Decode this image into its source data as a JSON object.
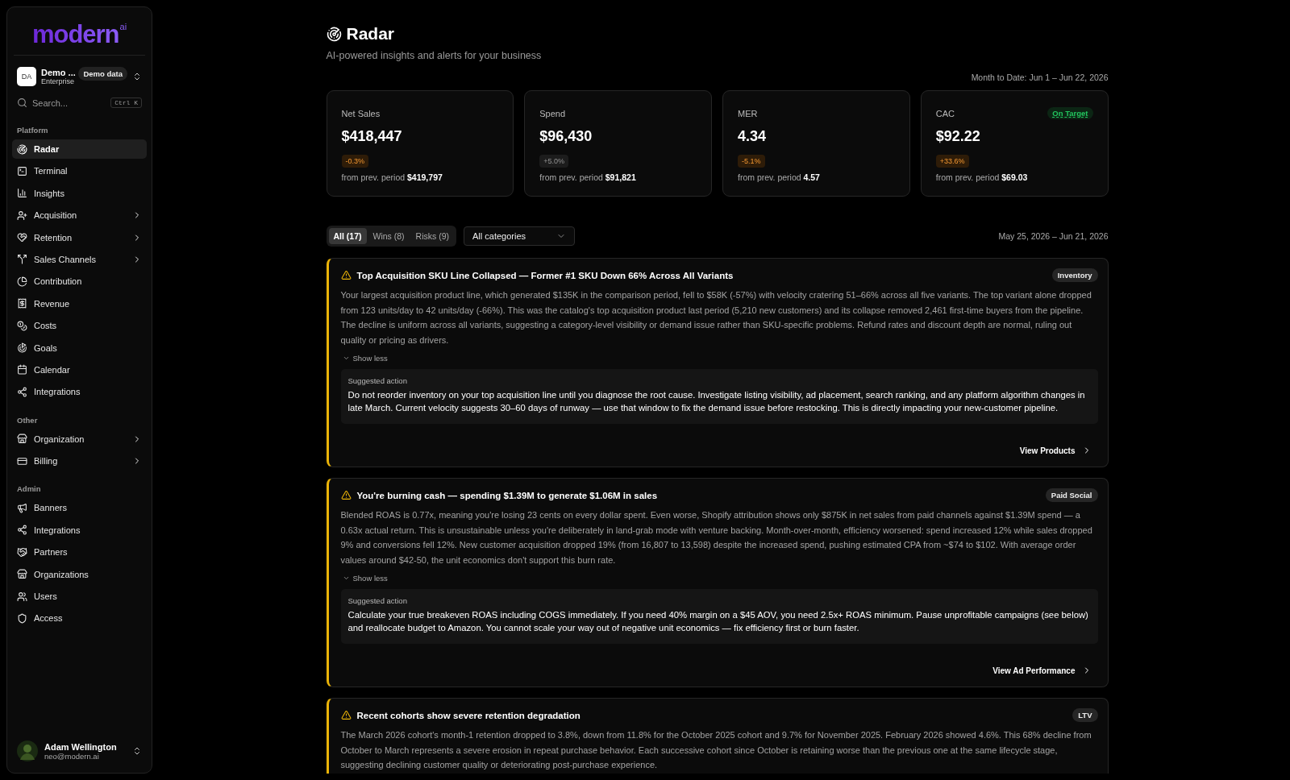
{
  "sidebar": {
    "logo": {
      "text": "modern",
      "superscript": "ai"
    },
    "org": {
      "initials": "DA",
      "name": "Demo ...",
      "plan": "Enterprise",
      "badge": "Demo data"
    },
    "search": {
      "placeholder": "Search...",
      "shortcut": "Ctrl K"
    },
    "sections": [
      {
        "title": "Platform",
        "items": [
          {
            "label": "Radar",
            "selected": true,
            "submenu": false
          },
          {
            "label": "Terminal",
            "selected": false,
            "submenu": false
          },
          {
            "label": "Insights",
            "selected": false,
            "submenu": false
          },
          {
            "label": "Acquisition",
            "selected": false,
            "submenu": true
          },
          {
            "label": "Retention",
            "selected": false,
            "submenu": true
          },
          {
            "label": "Sales Channels",
            "selected": false,
            "submenu": true
          },
          {
            "label": "Contribution",
            "selected": false,
            "submenu": false
          },
          {
            "label": "Revenue",
            "selected": false,
            "submenu": false
          },
          {
            "label": "Costs",
            "selected": false,
            "submenu": false
          },
          {
            "label": "Goals",
            "selected": false,
            "submenu": false
          },
          {
            "label": "Calendar",
            "selected": false,
            "submenu": false
          },
          {
            "label": "Integrations",
            "selected": false,
            "submenu": false
          }
        ]
      },
      {
        "title": "Other",
        "items": [
          {
            "label": "Organization",
            "selected": false,
            "submenu": true
          },
          {
            "label": "Billing",
            "selected": false,
            "submenu": true
          }
        ]
      },
      {
        "title": "Admin",
        "items": [
          {
            "label": "Banners",
            "selected": false,
            "submenu": false
          },
          {
            "label": "Integrations",
            "selected": false,
            "submenu": false
          },
          {
            "label": "Partners",
            "selected": false,
            "submenu": false
          },
          {
            "label": "Organizations",
            "selected": false,
            "submenu": false
          },
          {
            "label": "Users",
            "selected": false,
            "submenu": false
          },
          {
            "label": "Access",
            "selected": false,
            "submenu": false
          }
        ]
      }
    ],
    "user": {
      "name": "Adam Wellington",
      "email": "neo@modern.ai"
    }
  },
  "header": {
    "title": "Radar",
    "subtitle": "AI-powered insights and alerts for your business",
    "period": "Month to Date: Jun 1 – Jun 22, 2026"
  },
  "metrics": [
    {
      "label": "Net Sales",
      "value": "$418,447",
      "delta": "-0.3%",
      "color": "#2e1c08",
      "compare_label": "from prev. period",
      "compare_value": "$419,797"
    },
    {
      "label": "Spend",
      "value": "$96,430",
      "delta": "+5.0%",
      "color": "#1c1c1c",
      "compare_label": "from prev. period",
      "compare_value": "$91,821"
    },
    {
      "label": "MER",
      "value": "4.34",
      "delta": "-5.1%",
      "color": "#2e1c08",
      "compare_label": "from prev. period",
      "compare_value": "4.57"
    },
    {
      "label": "CAC",
      "value": "$92.22",
      "delta": "+33.6%",
      "color": "#2e1c08",
      "compare_label": "from prev. period",
      "compare_value": "$69.03",
      "status": "On Target"
    }
  ],
  "filters": {
    "tabs": [
      {
        "label": "All (17)",
        "selected": true
      },
      {
        "label": "Wins (8)",
        "selected": false
      },
      {
        "label": "Risks (9)",
        "selected": false
      }
    ],
    "category": "All categories",
    "range": "May 25, 2026 – Jun 21, 2026"
  },
  "alerts": [
    {
      "kind": "warning",
      "title": "Top Acquisition SKU Line Collapsed — Former #1 SKU Down 66% Across All Variants",
      "tag": "Inventory",
      "body": "Your largest acquisition product line, which generated $135K in the comparison period, fell to $58K (-57%) with velocity cratering 51–66% across all five variants. The top variant alone dropped from 123 units/day to 42 units/day (-66%). This was the catalog's top acquisition product last period (5,210 new customers) and its collapse removed 2,461 first-time buyers from the pipeline. The decline is uniform across all variants, suggesting a category-level visibility or demand issue rather than SKU-specific problems. Refund rates and discount depth are normal, ruling out quality or pricing as drivers.",
      "toggle": "Show less",
      "expanded": true,
      "action_label": "Suggested action",
      "action": "Do not reorder inventory on your top acquisition line until you diagnose the root cause. Investigate listing visibility, ad placement, search ranking, and any platform algorithm changes in late March. Current velocity suggests 30–60 days of runway — use that window to fix the demand issue before restocking. This is directly impacting your new-customer pipeline.",
      "link": "View Products"
    },
    {
      "kind": "warning",
      "title": "You're burning cash — spending $1.39M to generate $1.06M in sales",
      "tag": "Paid Social",
      "body": "Blended ROAS is 0.77x, meaning you're losing 23 cents on every dollar spent. Even worse, Shopify attribution shows only $875K in net sales from paid channels against $1.39M spend — a 0.63x actual return. This is unsustainable unless you're deliberately in land-grab mode with venture backing. Month-over-month, efficiency worsened: spend increased 12% while sales dropped 9% and conversions fell 12%. New customer acquisition dropped 19% (from 16,807 to 13,598) despite the increased spend, pushing estimated CPA from ~$74 to $102. With average order values around $42-50, the unit economics don't support this burn rate.",
      "toggle": "Show less",
      "expanded": true,
      "action_label": "Suggested action",
      "action": "Calculate your true breakeven ROAS including COGS immediately. If you need 40% margin on a $45 AOV, you need 2.5x+ ROAS minimum. Pause unprofitable campaigns (see below) and reallocate budget to Amazon. You cannot scale your way out of negative unit economics — fix efficiency first or burn faster.",
      "link": "View Ad Performance"
    },
    {
      "kind": "warning",
      "title": "Recent cohorts show severe retention degradation",
      "tag": "LTV",
      "body": "The March 2026 cohort's month-1 retention dropped to 3.8%, down from 11.8% for the October 2025 cohort and 9.7% for November 2025. February 2026 showed 4.6%. This 68% decline from October to March represents a severe erosion in repeat purchase behavior. Each successive cohort since October is retaining worse than the previous one at the same lifecycle stage, suggesting declining customer quality or deteriorating post-purchase experience."
    }
  ]
}
